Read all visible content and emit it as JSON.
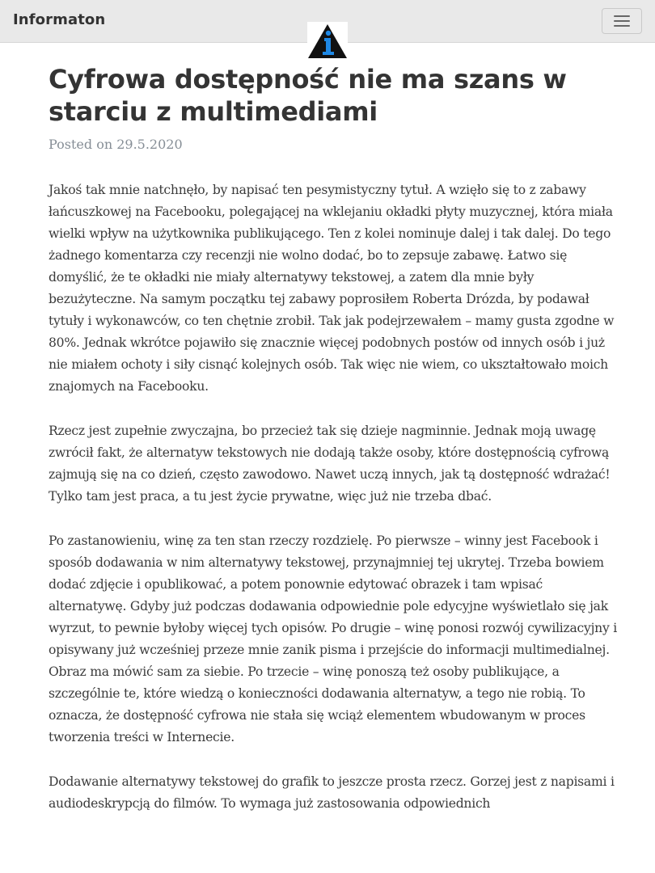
{
  "navbar": {
    "brand": "Informaton",
    "menu_icon": "hamburger-menu-icon"
  },
  "logo": {
    "icon": "info-triangle-logo-icon",
    "letter": "i",
    "colors": {
      "triangle": "#111111",
      "letter": "#1e88e5"
    }
  },
  "post": {
    "title": "Cyfrowa dostępność nie ma szans w starciu z multimediami",
    "meta_prefix": "Posted on",
    "date": "29.5.2020",
    "paragraphs": [
      "Jakoś tak mnie natchnęło, by napisać ten pesymistyczny tytuł. A wzięło się to z zabawy łańcuszkowej na Facebooku, polegającej na wklejaniu okładki płyty muzycznej, która miała wielki wpływ na użytkownika publikującego. Ten z kolei nominuje dalej i tak dalej. Do tego żadnego komentarza czy recenzji nie wolno dodać, bo to zepsuje zabawę. Łatwo się domyślić, że te okładki nie miały alternatywy tekstowej, a zatem dla mnie były bezużyteczne. Na samym początku tej zabawy poprosiłem Roberta Drózda, by podawał tytuły i wykonawców, co ten chętnie zrobił. Tak jak podejrzewałem – mamy gusta zgodne w 80%. Jednak wkrótce pojawiło się znacznie więcej podobnych postów od innych osób i już nie miałem ochoty i siły cisnąć kolejnych osób. Tak więc nie wiem, co ukształtowało moich znajomych na Facebooku.",
      "Rzecz jest zupełnie zwyczajna, bo przecież tak się dzieje nagminnie. Jednak moją uwagę zwrócił fakt, że alternatyw tekstowych nie dodają także osoby, które dostępnością cyfrową zajmują się na co dzień, często zawodowo. Nawet uczą innych, jak tą dostępność wdrażać! Tylko tam jest praca, a tu jest życie prywatne, więc już nie trzeba dbać.",
      "Po zastanowieniu, winę za ten stan rzeczy rozdzielę. Po pierwsze – winny jest Facebook i sposób dodawania w nim alternatywy tekstowej, przynajmniej tej ukrytej. Trzeba bowiem dodać zdjęcie i opublikować, a potem ponownie edytować obrazek i tam wpisać alternatywę. Gdyby już podczas dodawania odpowiednie pole edycyjne wyświetlało się jak wyrzut, to pewnie byłoby więcej tych opisów. Po drugie – winę ponosi rozwój cywilizacyjny i opisywany już wcześniej przeze mnie zanik pisma i przejście do informacji multimedialnej. Obraz ma mówić sam za siebie. Po trzecie – winę ponoszą też osoby publikujące, a szczególnie te, które wiedzą o konieczności dodawania alternatyw, a tego nie robią. To oznacza, że dostępność cyfrowa nie stała się wciąż elementem wbudowanym w proces tworzenia treści w Internecie.",
      "Dodawanie alternatywy tekstowej do grafik to jeszcze prosta rzecz. Gorzej jest z napisami i audiodeskrypcją do filmów. To wymaga już zastosowania odpowiednich"
    ]
  }
}
